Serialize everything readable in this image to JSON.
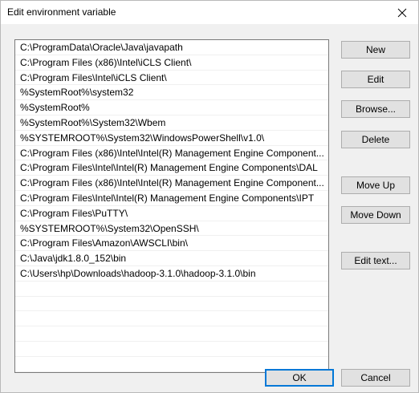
{
  "window": {
    "title": "Edit environment variable"
  },
  "path_list": {
    "entries": [
      "C:\\ProgramData\\Oracle\\Java\\javapath",
      "C:\\Program Files (x86)\\Intel\\iCLS Client\\",
      "C:\\Program Files\\Intel\\iCLS Client\\",
      "%SystemRoot%\\system32",
      "%SystemRoot%",
      "%SystemRoot%\\System32\\Wbem",
      "%SYSTEMROOT%\\System32\\WindowsPowerShell\\v1.0\\",
      "C:\\Program Files (x86)\\Intel\\Intel(R) Management Engine Component...",
      "C:\\Program Files\\Intel\\Intel(R) Management Engine Components\\DAL",
      "C:\\Program Files (x86)\\Intel\\Intel(R) Management Engine Component...",
      "C:\\Program Files\\Intel\\Intel(R) Management Engine Components\\IPT",
      "C:\\Program Files\\PuTTY\\",
      "%SYSTEMROOT%\\System32\\OpenSSH\\",
      "C:\\Program Files\\Amazon\\AWSCLI\\bin\\",
      "C:\\Java\\jdk1.8.0_152\\bin",
      "C:\\Users\\hp\\Downloads\\hadoop-3.1.0\\hadoop-3.1.0\\bin"
    ]
  },
  "buttons": {
    "new": "New",
    "edit": "Edit",
    "browse": "Browse...",
    "delete": "Delete",
    "move_up": "Move Up",
    "move_down": "Move Down",
    "edit_text": "Edit text...",
    "ok": "OK",
    "cancel": "Cancel"
  },
  "icons": {
    "close": "close-icon"
  },
  "colors": {
    "default_button_border": "#0078d7",
    "button_face": "#e1e1e1",
    "dialog_background": "#f0f0f0"
  }
}
